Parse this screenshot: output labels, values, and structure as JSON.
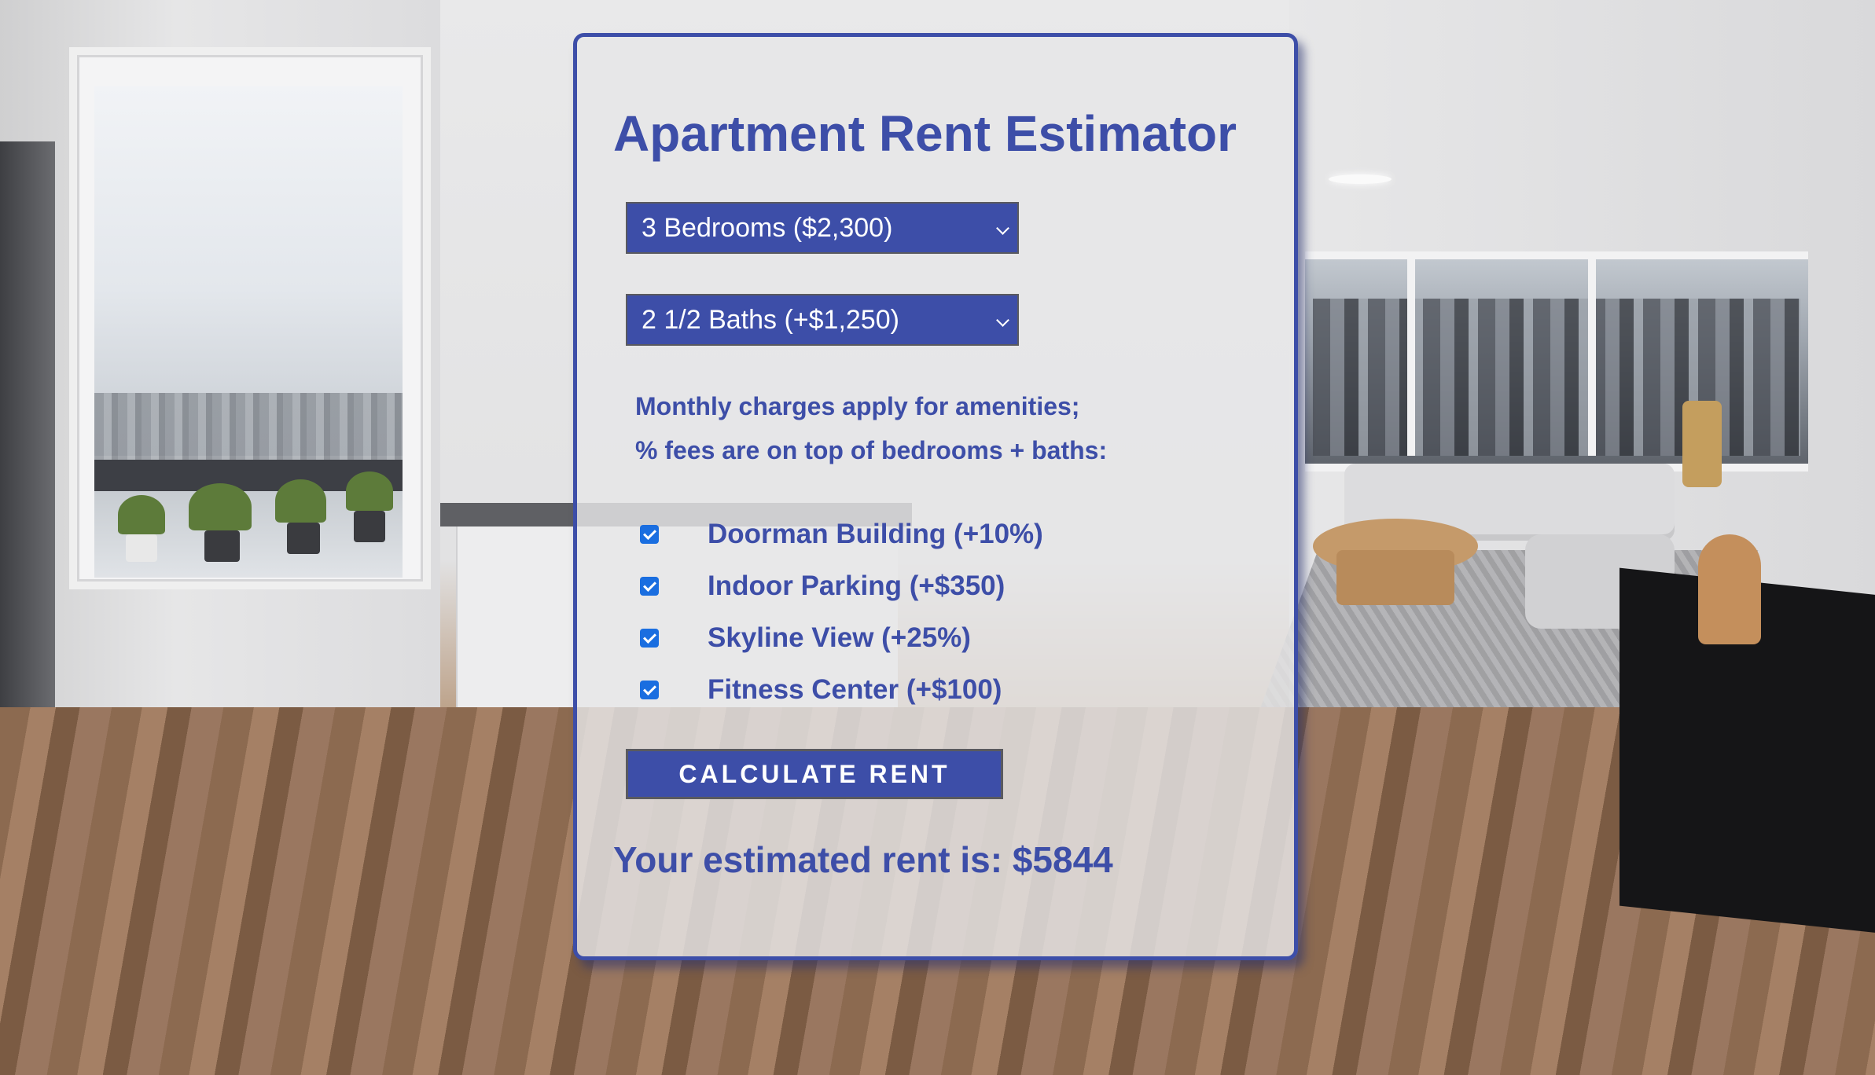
{
  "app": {
    "title": "Apartment Rent Estimator"
  },
  "form": {
    "bedrooms_select": {
      "selected": "3 Bedrooms ($2,300)"
    },
    "baths_select": {
      "selected": "2 1/2 Baths (+$1,250)"
    },
    "note_line1": "Monthly charges apply for amenities;",
    "note_line2": "% fees are on top of bedrooms + baths:",
    "amenities": [
      {
        "label": "Doorman Building (+10%)",
        "checked": true
      },
      {
        "label": "Indoor Parking (+$350)",
        "checked": true
      },
      {
        "label": "Skyline View (+25%)",
        "checked": true
      },
      {
        "label": "Fitness Center (+$100)",
        "checked": true
      }
    ],
    "calculate_button": "CALCULATE RENT",
    "result_text": "Your estimated rent is: $5844"
  },
  "colors": {
    "accent": "#3d4ea8",
    "checkbox": "#1a6ee0",
    "panel_bg": "#e6e6e8"
  },
  "icons": {
    "select_arrow": "chevron-down-icon",
    "checkbox_mark": "checkmark-icon"
  }
}
